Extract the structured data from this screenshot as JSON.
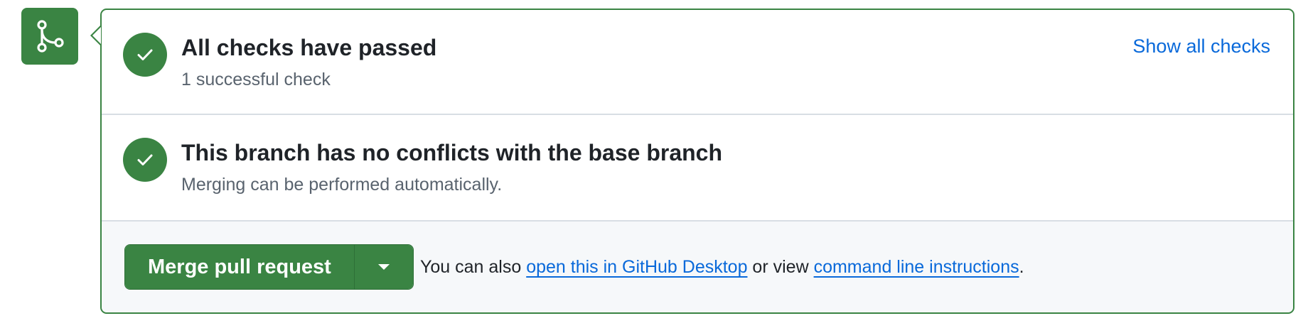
{
  "icons": {
    "merge_icon": "git-merge-icon",
    "check_icon": "check-icon",
    "caret_icon": "triangle-down-icon"
  },
  "colors": {
    "success_green": "#3a8443",
    "link_blue": "#0969da",
    "muted_text": "#59636e",
    "border_gray": "#d8dee4",
    "footer_bg": "#f6f8fa"
  },
  "checks": {
    "title": "All checks have passed",
    "subtitle": "1 successful check",
    "show_all_label": "Show all checks"
  },
  "conflicts": {
    "title": "This branch has no conflicts with the base branch",
    "subtitle": "Merging can be performed automatically."
  },
  "merge": {
    "button_label": "Merge pull request",
    "also_prefix": "You can also ",
    "desktop_link": "open this in GitHub Desktop",
    "middle_text": " or view ",
    "cli_link": "command line instructions",
    "suffix": "."
  }
}
